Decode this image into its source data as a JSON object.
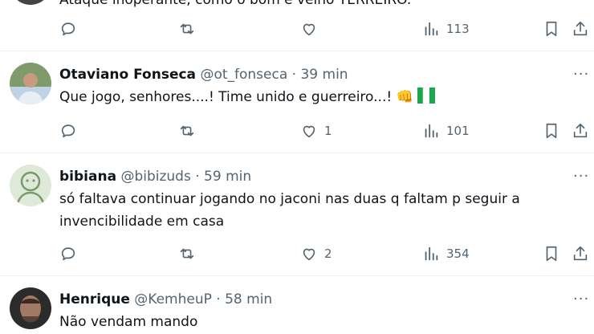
{
  "top_partial": {
    "body_text": "Ataque inoperante, como o bom e velho TERREIRO.",
    "views": "113"
  },
  "replies": [
    {
      "name": "Otaviano Fonseca",
      "handle": "@ot_fonseca",
      "separator": "·",
      "time": "39 min",
      "text": "Que jogo, senhores....! Time unido e guerreiro...!",
      "emoji": "👊",
      "likes": "1",
      "views": "101"
    },
    {
      "name": "bibiana",
      "handle": "@bibizuds",
      "separator": "·",
      "time": "59 min",
      "text": "só faltava continuar jogando no jaconi nas duas q faltam p seguir a invencibilidade em casa",
      "likes": "2",
      "views": "354"
    },
    {
      "name": "Henrique",
      "handle": "@KemheuP",
      "separator": "·",
      "time": "58 min",
      "text": "Não vendam mando"
    }
  ],
  "more_label": "···",
  "icons": {
    "reply": "reply-icon",
    "retweet": "retweet-icon",
    "like": "heart-icon",
    "views": "views-icon",
    "bookmark": "bookmark-icon",
    "share": "share-icon"
  },
  "colors": {
    "text": "#0f1419",
    "muted": "#536471",
    "divider": "#eff3f4",
    "flag_green": "#19a84c"
  }
}
